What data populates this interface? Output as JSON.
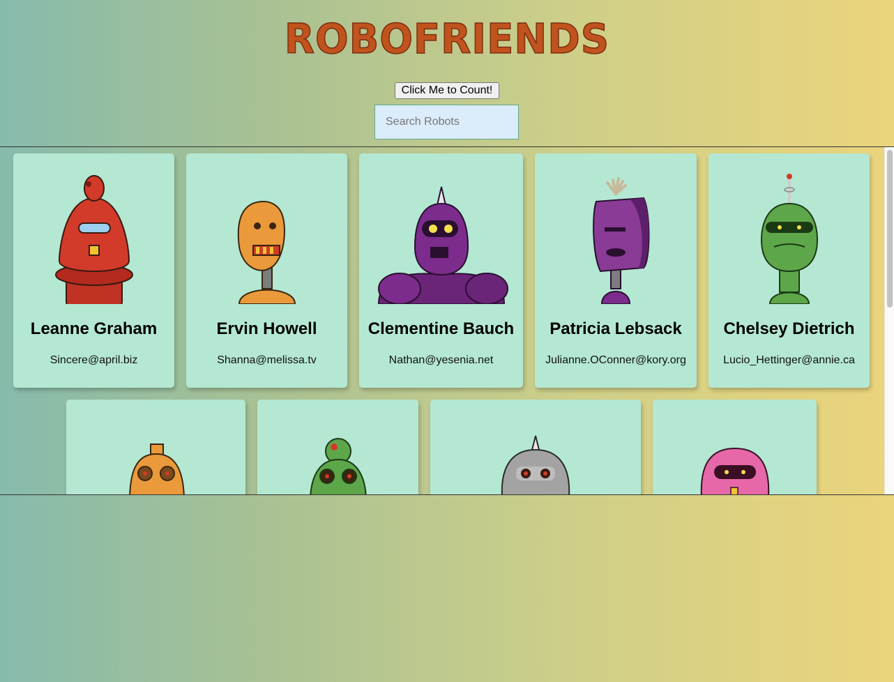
{
  "header": {
    "logo_text": "ROBOFRIENDS",
    "count_button_label": "Click Me to Count!",
    "search_placeholder": "Search Robots"
  },
  "robots": [
    {
      "name": "Leanne Graham",
      "email": "Sincere@april.biz",
      "color": "#d23b29",
      "icon": "red-robot-image"
    },
    {
      "name": "Ervin Howell",
      "email": "Shanna@melissa.tv",
      "color": "#ea9a3a",
      "icon": "orange-robot-image"
    },
    {
      "name": "Clementine Bauch",
      "email": "Nathan@yesenia.net",
      "color": "#7c2c8c",
      "icon": "purple-robot-image"
    },
    {
      "name": "Patricia Lebsack",
      "email": "Julianne.OConner@kory.org",
      "color": "#8a3b95",
      "icon": "purple-robot-image"
    },
    {
      "name": "Chelsey Dietrich",
      "email": "Lucio_Hettinger@annie.ca",
      "color": "#5ea64a",
      "icon": "green-robot-image"
    },
    {
      "name": "",
      "email": "",
      "color": "#ea9a3a",
      "icon": "orange-robot-image"
    },
    {
      "name": "",
      "email": "",
      "color": "#5ea64a",
      "icon": "green-robot-image"
    },
    {
      "name": "",
      "email": "",
      "color": "#a3a3a3",
      "icon": "gray-robot-image"
    },
    {
      "name": "",
      "email": "",
      "color": "#e668a8",
      "icon": "pink-robot-image"
    }
  ]
}
